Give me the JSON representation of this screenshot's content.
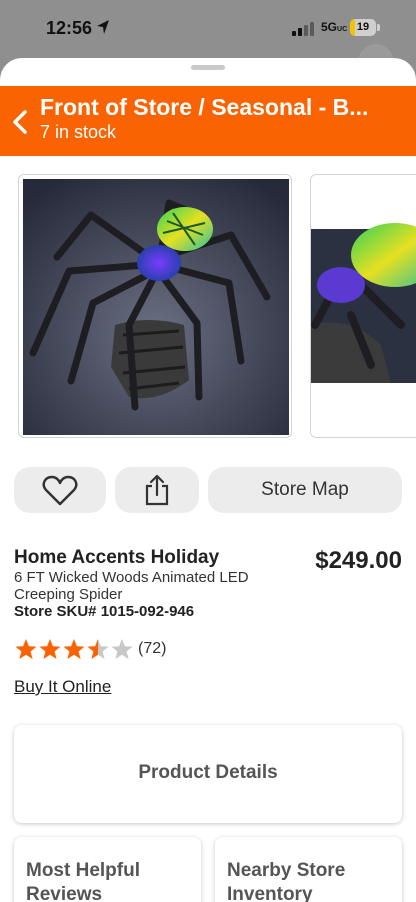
{
  "status_bar": {
    "time": "12:56",
    "network": "5G",
    "network_suffix": "UC",
    "battery": "19",
    "battery_level": 0.19
  },
  "header": {
    "title": "Front of Store / Seasonal - B...",
    "subtitle": "7 in stock"
  },
  "gallery": {
    "images": [
      "spider-product-main",
      "spider-product-closeup"
    ]
  },
  "actions": {
    "store_map_label": "Store Map"
  },
  "product": {
    "brand": "Home Accents Holiday",
    "description": "6 FT Wicked Woods Animated LED Creeping Spider",
    "sku": "Store SKU# 1015-092-946",
    "price": "$249.00",
    "rating": 3.5,
    "rating_max": 5,
    "review_count": "(72)",
    "buy_online": "Buy It Online"
  },
  "cards": {
    "product_details": "Product Details",
    "most_helpful_reviews": "Most Helpful Reviews",
    "nearby_store_inventory": "Nearby Store Inventory"
  },
  "colors": {
    "brand_orange": "#f96302",
    "star": "#f96302"
  }
}
